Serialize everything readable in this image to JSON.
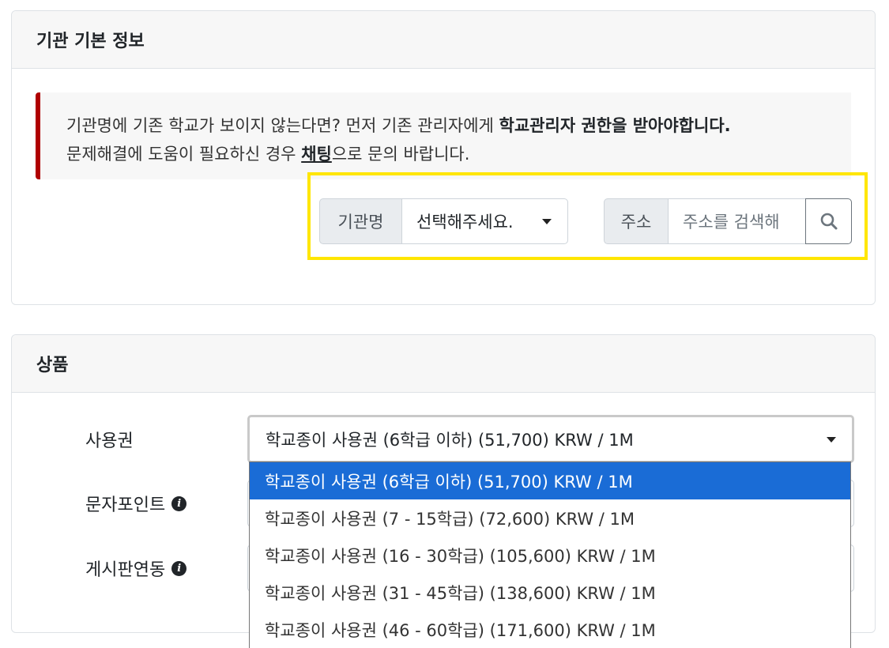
{
  "institution_card": {
    "title": "기관 기본 정보",
    "notice": {
      "line1_prefix": "기관명에 기존 학교가 보이지 않는다면? 먼저 기존 관리자에게 ",
      "line1_strong": "학교관리자 권한을 받아야합니다.",
      "line2_prefix": "문제해결에 도움이 필요하신 경우 ",
      "line2_link": "채팅",
      "line2_suffix": "으로 문의 바랍니다."
    },
    "institution_select": {
      "label": "기관명",
      "value": "선택해주세요."
    },
    "address_search": {
      "label": "주소",
      "placeholder": "주소를 검색해",
      "button_icon": "search-icon"
    },
    "highlight_color": "#ffe600"
  },
  "product_card": {
    "title": "상품",
    "fields": {
      "license_label": "사용권",
      "sms_label": "문자포인트",
      "board_label": "게시판연동"
    },
    "license_select": {
      "value": "학교종이 사용권 (6학급 이하) (51,700) KRW / 1M",
      "options": [
        "학교종이 사용권 (6학급 이하) (51,700) KRW / 1M",
        "학교종이 사용권 (7 - 15학급) (72,600) KRW / 1M",
        "학교종이 사용권 (16 - 30학급) (105,600) KRW / 1M",
        "학교종이 사용권 (31 - 45학급) (138,600) KRW / 1M",
        "학교종이 사용권 (46 - 60학급) (171,600) KRW / 1M"
      ],
      "selected_index": 0,
      "selected_color": "#1a6cd6"
    }
  },
  "accent_colors": {
    "notice_border": "#b00000"
  }
}
